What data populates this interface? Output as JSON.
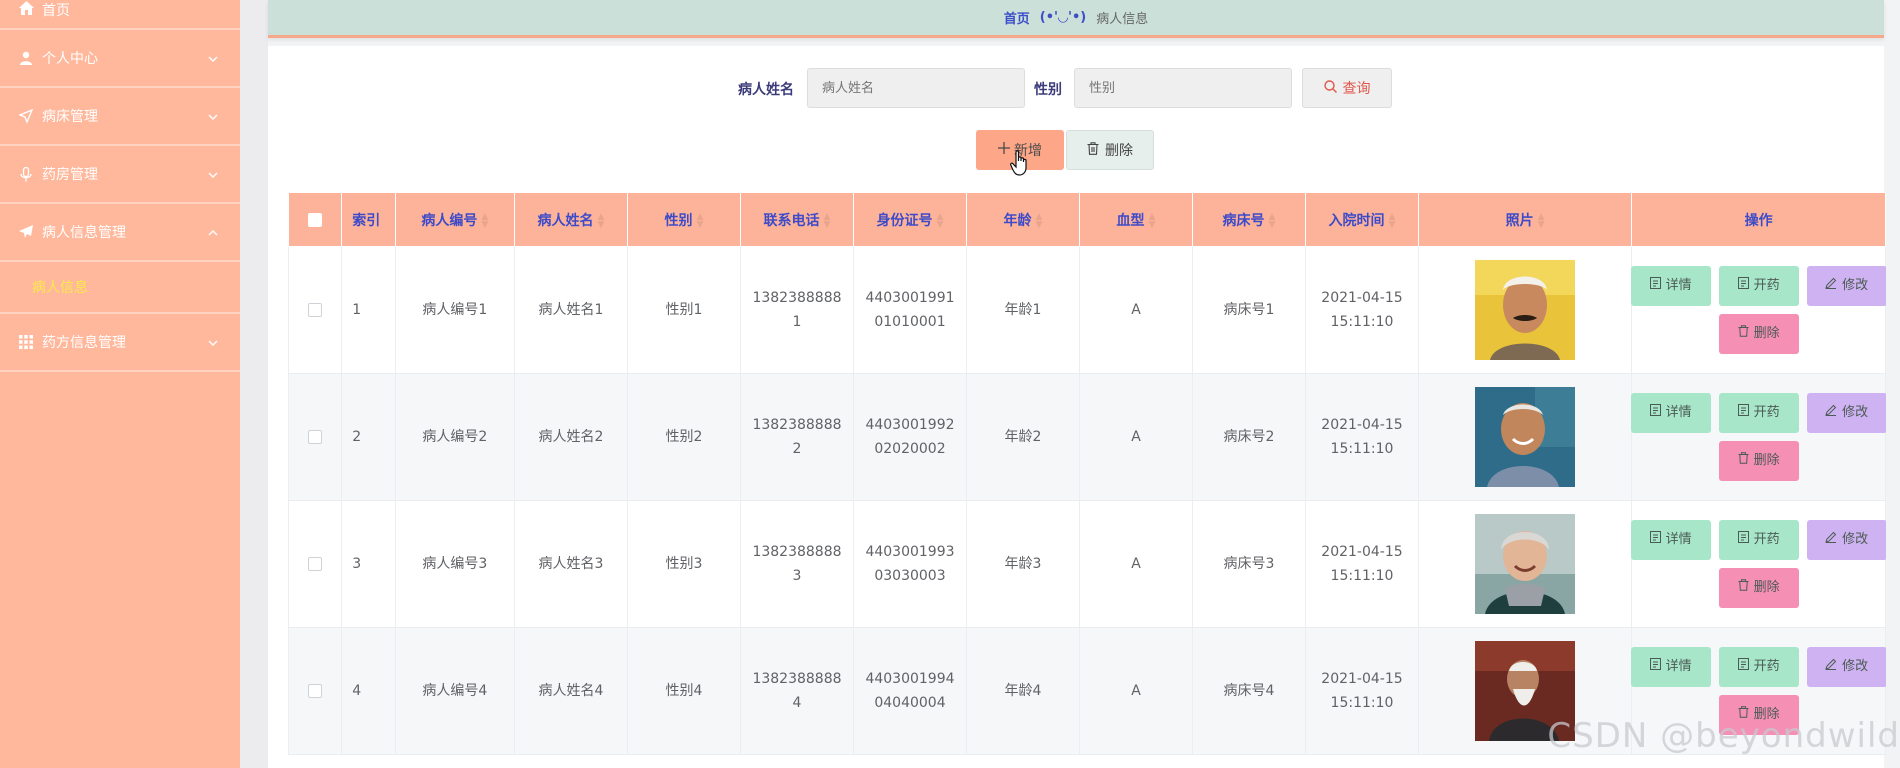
{
  "sidebar": {
    "home": "首页",
    "items": [
      {
        "label": "个人中心",
        "icon": "user-icon",
        "expanded": false
      },
      {
        "label": "病床管理",
        "icon": "send-icon",
        "expanded": false
      },
      {
        "label": "药房管理",
        "icon": "mic-icon",
        "expanded": false
      },
      {
        "label": "病人信息管理",
        "icon": "plane-icon",
        "expanded": true
      },
      {
        "label": "药方信息管理",
        "icon": "grid-icon",
        "expanded": false
      }
    ],
    "submenu_active": "病人信息"
  },
  "breadcrumb": {
    "home": "首页",
    "separator": "(•'◡'•)",
    "current": "病人信息"
  },
  "search": {
    "name_label": "病人姓名",
    "name_placeholder": "病人姓名",
    "gender_label": "性别",
    "gender_placeholder": "性别",
    "query_button": "查询"
  },
  "actions": {
    "add": "新增",
    "delete": "删除"
  },
  "table": {
    "headers": [
      "索引",
      "病人编号",
      "病人姓名",
      "性别",
      "联系电话",
      "身份证号",
      "年龄",
      "血型",
      "病床号",
      "入院时间",
      "照片",
      "操作"
    ],
    "rows": [
      {
        "index": "1",
        "code": "病人编号1",
        "name": "病人姓名1",
        "gender": "性别1",
        "phone": [
          "1382388888",
          "1"
        ],
        "id_no": [
          "44030019910",
          "1010001"
        ],
        "id_split": [
          "4403001991",
          "01010001"
        ],
        "age": "年龄1",
        "blood": "A",
        "bed": "病床号1",
        "time": [
          "2021-04-15",
          "15:11:10"
        ]
      },
      {
        "index": "2",
        "code": "病人编号2",
        "name": "病人姓名2",
        "gender": "性别2",
        "phone": [
          "1382388888",
          "2"
        ],
        "id_split": [
          "4403001992",
          "02020002"
        ],
        "age": "年龄2",
        "blood": "A",
        "bed": "病床号2",
        "time": [
          "2021-04-15",
          "15:11:10"
        ]
      },
      {
        "index": "3",
        "code": "病人编号3",
        "name": "病人姓名3",
        "gender": "性别3",
        "phone": [
          "1382388888",
          "3"
        ],
        "id_split": [
          "4403001993",
          "03030003"
        ],
        "age": "年龄3",
        "blood": "A",
        "bed": "病床号3",
        "time": [
          "2021-04-15",
          "15:11:10"
        ]
      },
      {
        "index": "4",
        "code": "病人编号4",
        "name": "病人姓名4",
        "gender": "性别4",
        "phone": [
          "1382388888",
          "4"
        ],
        "id_split": [
          "4403001994",
          "04040004"
        ],
        "age": "年龄4",
        "blood": "A",
        "bed": "病床号4",
        "time": [
          "2021-04-15",
          "15:11:10"
        ]
      }
    ],
    "op_labels": {
      "detail": "详情",
      "prescribe": "开药",
      "edit": "修改",
      "delete": "删除"
    }
  },
  "watermark": "CSDN @beyondwild",
  "colors": {
    "sidebar_bg": "#ffb89c",
    "header_bg": "#fdb39a",
    "header_text": "#3d4bc8",
    "btn_green": "#a7e6c9",
    "btn_purple": "#cfb2f1",
    "btn_pink": "#f58fb4",
    "btn_add": "#fda688",
    "submenu_active": "#fbe94b"
  }
}
